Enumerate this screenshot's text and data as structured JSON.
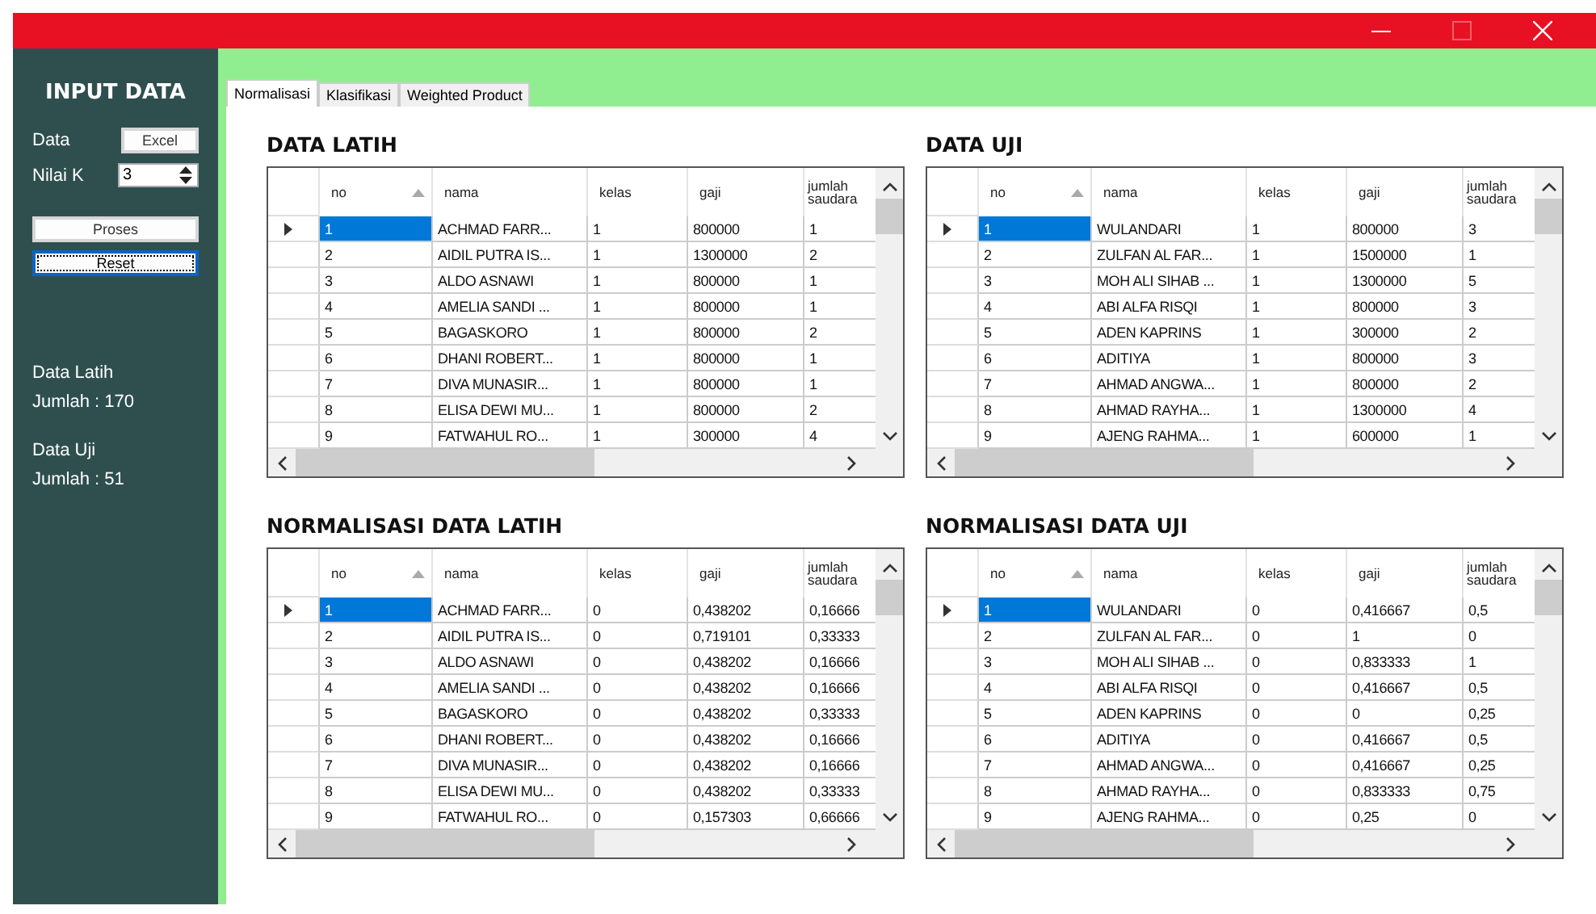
{
  "window": {
    "controls": [
      {
        "kind": "minimize",
        "disabled": false
      },
      {
        "kind": "maximize",
        "disabled": true
      },
      {
        "kind": "close",
        "disabled": false
      }
    ]
  },
  "sidebar": {
    "title": "INPUT DATA",
    "data_label": "Data",
    "excel_button": "Excel",
    "k_label": "Nilai K",
    "k_value": "3",
    "buttons": [
      {
        "label": "Proses",
        "focused": false
      },
      {
        "label": "Reset",
        "focused": true
      }
    ],
    "stats": [
      {
        "title": "Data Latih",
        "count": "Jumlah : 170"
      },
      {
        "title": "Data Uji",
        "count": "Jumlah : 51"
      }
    ]
  },
  "tabs": [
    {
      "label": "Normalisasi",
      "selected": true
    },
    {
      "label": "Klasifikasi",
      "selected": false
    },
    {
      "label": "Weighted Product",
      "selected": false
    }
  ],
  "panels": [
    {
      "title": "DATA LATIH",
      "columns": [
        {
          "label": "no",
          "sorted": true
        },
        {
          "label": "nama",
          "sorted": false
        },
        {
          "label": "kelas",
          "sorted": false
        },
        {
          "label": "gaji",
          "sorted": false
        },
        {
          "label": "jumlah saudara",
          "sorted": false
        }
      ],
      "rows": [
        {
          "selected": true,
          "cells": [
            "1",
            "ACHMAD FARR...",
            "1",
            "800000",
            "1"
          ]
        },
        {
          "selected": false,
          "cells": [
            "2",
            "AIDIL PUTRA IS...",
            "1",
            "1300000",
            "2"
          ]
        },
        {
          "selected": false,
          "cells": [
            "3",
            "ALDO ASNAWI",
            "1",
            "800000",
            "1"
          ]
        },
        {
          "selected": false,
          "cells": [
            "4",
            "AMELIA SANDI ...",
            "1",
            "800000",
            "1"
          ]
        },
        {
          "selected": false,
          "cells": [
            "5",
            "BAGASKORO",
            "1",
            "800000",
            "2"
          ]
        },
        {
          "selected": false,
          "cells": [
            "6",
            "DHANI ROBERT...",
            "1",
            "800000",
            "1"
          ]
        },
        {
          "selected": false,
          "cells": [
            "7",
            "DIVA MUNASIR...",
            "1",
            "800000",
            "1"
          ]
        },
        {
          "selected": false,
          "cells": [
            "8",
            "ELISA DEWI MU...",
            "1",
            "800000",
            "2"
          ]
        },
        {
          "selected": false,
          "cells": [
            "9",
            "FATWAHUL RO...",
            "1",
            "300000",
            "4"
          ]
        }
      ]
    },
    {
      "title": "DATA UJI",
      "columns": [
        {
          "label": "no",
          "sorted": true
        },
        {
          "label": "nama",
          "sorted": false
        },
        {
          "label": "kelas",
          "sorted": false
        },
        {
          "label": "gaji",
          "sorted": false
        },
        {
          "label": "jumlah saudara",
          "sorted": false
        }
      ],
      "rows": [
        {
          "selected": true,
          "cells": [
            "1",
            "WULANDARI",
            "1",
            "800000",
            "3"
          ]
        },
        {
          "selected": false,
          "cells": [
            "2",
            "ZULFAN AL FAR...",
            "1",
            "1500000",
            "1"
          ]
        },
        {
          "selected": false,
          "cells": [
            "3",
            "MOH ALI SIHAB ...",
            "1",
            "1300000",
            "5"
          ]
        },
        {
          "selected": false,
          "cells": [
            "4",
            "ABI ALFA RISQI",
            "1",
            "800000",
            "3"
          ]
        },
        {
          "selected": false,
          "cells": [
            "5",
            "ADEN KAPRINS",
            "1",
            "300000",
            "2"
          ]
        },
        {
          "selected": false,
          "cells": [
            "6",
            "ADITIYA",
            "1",
            "800000",
            "3"
          ]
        },
        {
          "selected": false,
          "cells": [
            "7",
            "AHMAD ANGWA...",
            "1",
            "800000",
            "2"
          ]
        },
        {
          "selected": false,
          "cells": [
            "8",
            "AHMAD RAYHA...",
            "1",
            "1300000",
            "4"
          ]
        },
        {
          "selected": false,
          "cells": [
            "9",
            "AJENG RAHMA...",
            "1",
            "600000",
            "1"
          ]
        }
      ]
    },
    {
      "title": "NORMALISASI DATA LATIH",
      "columns": [
        {
          "label": "no",
          "sorted": true
        },
        {
          "label": "nama",
          "sorted": false
        },
        {
          "label": "kelas",
          "sorted": false
        },
        {
          "label": "gaji",
          "sorted": false
        },
        {
          "label": "jumlah saudara",
          "sorted": false
        }
      ],
      "rows": [
        {
          "selected": true,
          "cells": [
            "1",
            "ACHMAD FARR...",
            "0",
            "0,438202",
            "0,16666"
          ]
        },
        {
          "selected": false,
          "cells": [
            "2",
            "AIDIL PUTRA IS...",
            "0",
            "0,719101",
            "0,33333"
          ]
        },
        {
          "selected": false,
          "cells": [
            "3",
            "ALDO ASNAWI",
            "0",
            "0,438202",
            "0,16666"
          ]
        },
        {
          "selected": false,
          "cells": [
            "4",
            "AMELIA SANDI ...",
            "0",
            "0,438202",
            "0,16666"
          ]
        },
        {
          "selected": false,
          "cells": [
            "5",
            "BAGASKORO",
            "0",
            "0,438202",
            "0,33333"
          ]
        },
        {
          "selected": false,
          "cells": [
            "6",
            "DHANI ROBERT...",
            "0",
            "0,438202",
            "0,16666"
          ]
        },
        {
          "selected": false,
          "cells": [
            "7",
            "DIVA MUNASIR...",
            "0",
            "0,438202",
            "0,16666"
          ]
        },
        {
          "selected": false,
          "cells": [
            "8",
            "ELISA DEWI MU...",
            "0",
            "0,438202",
            "0,33333"
          ]
        },
        {
          "selected": false,
          "cells": [
            "9",
            "FATWAHUL RO...",
            "0",
            "0,157303",
            "0,66666"
          ]
        }
      ]
    },
    {
      "title": "NORMALISASI DATA UJI",
      "columns": [
        {
          "label": "no",
          "sorted": true
        },
        {
          "label": "nama",
          "sorted": false
        },
        {
          "label": "kelas",
          "sorted": false
        },
        {
          "label": "gaji",
          "sorted": false
        },
        {
          "label": "jumlah saudara",
          "sorted": false
        }
      ],
      "rows": [
        {
          "selected": true,
          "cells": [
            "1",
            "WULANDARI",
            "0",
            "0,416667",
            "0,5"
          ]
        },
        {
          "selected": false,
          "cells": [
            "2",
            "ZULFAN AL FAR...",
            "0",
            "1",
            "0"
          ]
        },
        {
          "selected": false,
          "cells": [
            "3",
            "MOH ALI SIHAB ...",
            "0",
            "0,833333",
            "1"
          ]
        },
        {
          "selected": false,
          "cells": [
            "4",
            "ABI ALFA RISQI",
            "0",
            "0,416667",
            "0,5"
          ]
        },
        {
          "selected": false,
          "cells": [
            "5",
            "ADEN KAPRINS",
            "0",
            "0",
            "0,25"
          ]
        },
        {
          "selected": false,
          "cells": [
            "6",
            "ADITIYA",
            "0",
            "0,416667",
            "0,5"
          ]
        },
        {
          "selected": false,
          "cells": [
            "7",
            "AHMAD ANGWA...",
            "0",
            "0,416667",
            "0,25"
          ]
        },
        {
          "selected": false,
          "cells": [
            "8",
            "AHMAD RAYHA...",
            "0",
            "0,833333",
            "0,75"
          ]
        },
        {
          "selected": false,
          "cells": [
            "9",
            "AJENG RAHMA...",
            "0",
            "0,25",
            "0"
          ]
        }
      ]
    }
  ]
}
